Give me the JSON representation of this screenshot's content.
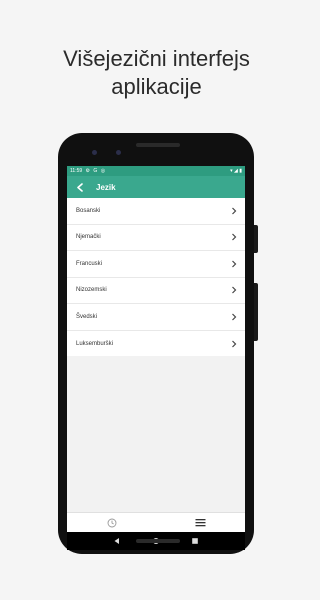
{
  "headline": {
    "line1": "Višejezični interfejs",
    "line2": "aplikacije"
  },
  "status_bar": {
    "time": "11:59",
    "left_icons": [
      "settings-icon",
      "google-icon",
      "app-icon"
    ],
    "right_icons": [
      "wifi-icon",
      "signal-icon",
      "battery-icon"
    ]
  },
  "app_bar": {
    "title": "Jezik",
    "back_icon": "arrow-left-icon"
  },
  "languages": [
    "Bosanski",
    "Njemački",
    "Francuski",
    "Nizozemski",
    "Švedski",
    "Luksemburški"
  ],
  "bottom_nav": {
    "tabs": [
      "clock-icon",
      "menu-icon"
    ]
  },
  "system_nav": [
    "back-triangle-icon",
    "home-circle-icon",
    "recents-square-icon"
  ],
  "colors": {
    "accent": "#3aa88e",
    "status": "#2e9c80"
  }
}
